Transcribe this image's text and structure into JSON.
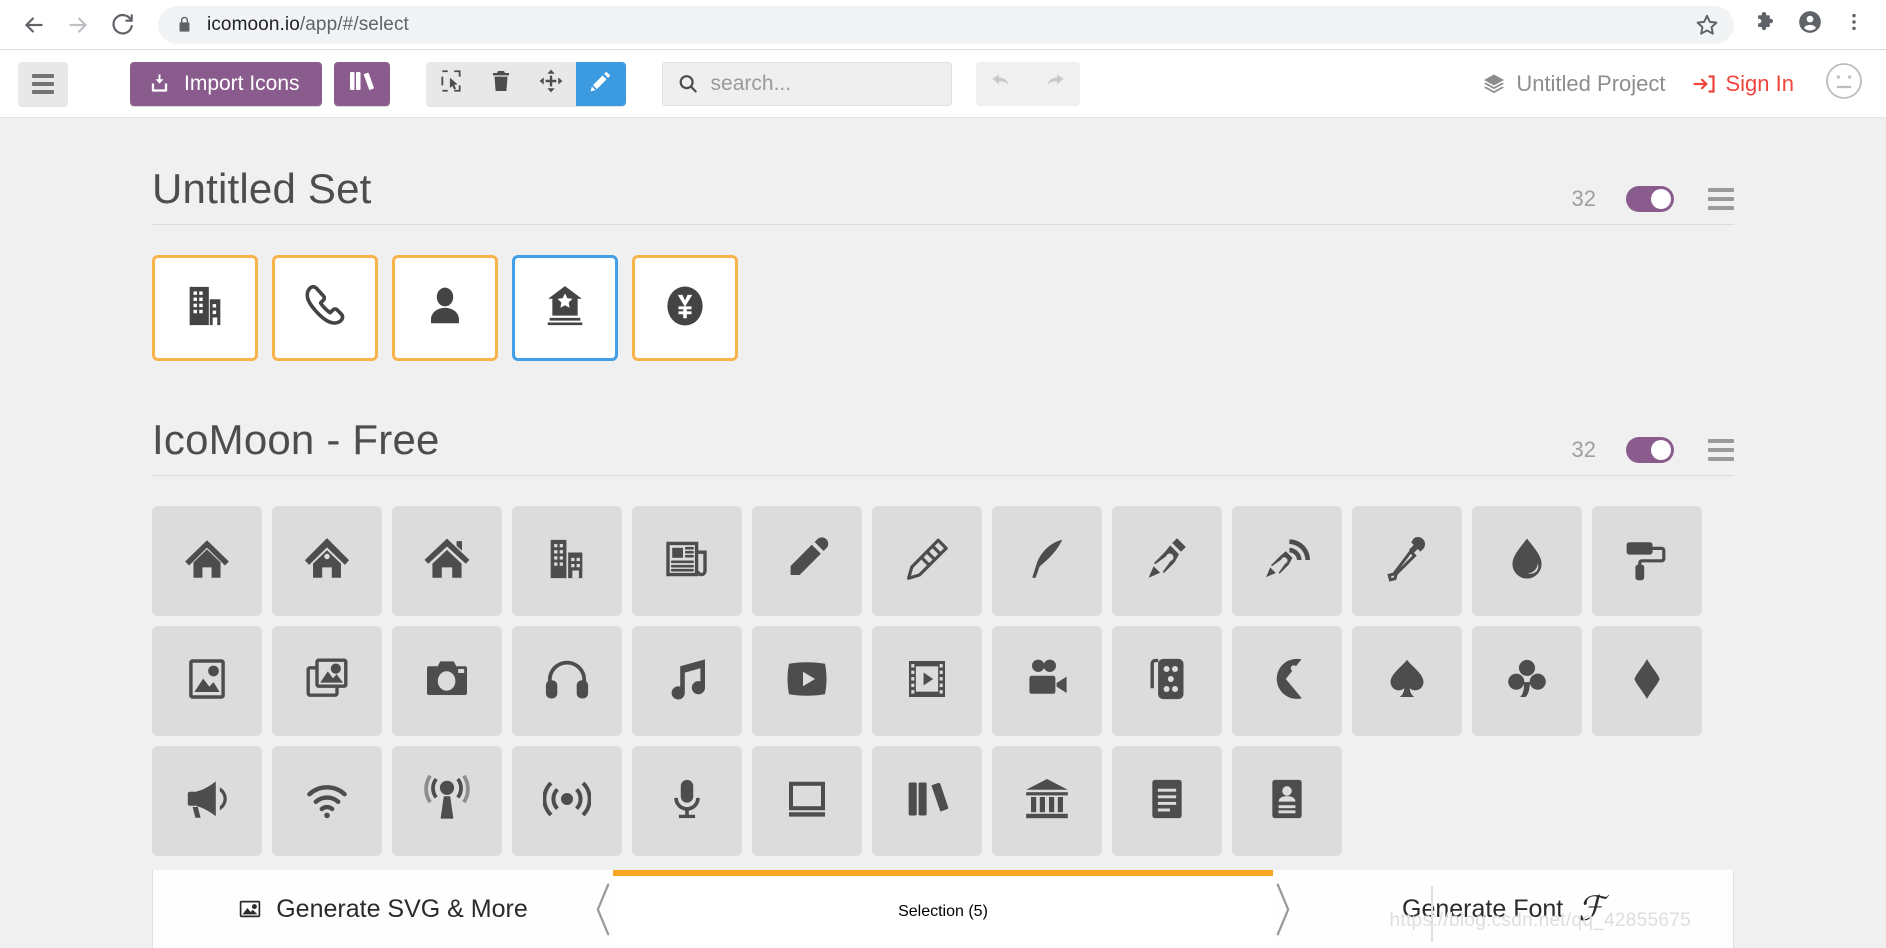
{
  "browser": {
    "back_icon": "back-arrow-icon",
    "forward_icon": "forward-arrow-icon",
    "reload_icon": "reload-icon",
    "lock_icon": "lock-icon",
    "url_domain": "icomoon.io",
    "url_path": "/app/#/select",
    "bookmark_icon": "star-icon",
    "extensions_icon": "puzzle-piece-icon",
    "profile_icon": "account-avatar-icon",
    "menu_icon": "three-dot-menu-icon"
  },
  "toolbar": {
    "menu_label": "menu",
    "import_label": "Import Icons",
    "library_label": "library",
    "tools": [
      {
        "name": "select-tool",
        "label": "Select",
        "active": false
      },
      {
        "name": "delete-tool",
        "label": "Delete",
        "active": false
      },
      {
        "name": "move-tool",
        "label": "Move",
        "active": false
      },
      {
        "name": "edit-tool",
        "label": "Edit",
        "active": true
      }
    ],
    "search_placeholder": "search...",
    "search_value": "",
    "undo_label": "Undo",
    "redo_label": "Redo",
    "project_name": "Untitled Project",
    "signin_label": "Sign In",
    "face_label": "Account"
  },
  "sets": [
    {
      "title": "Untitled Set",
      "count": "32",
      "toggle_on": true,
      "icons": [
        {
          "name": "office-building-icon",
          "selected": "orange"
        },
        {
          "name": "phone-icon",
          "selected": "orange"
        },
        {
          "name": "user-icon",
          "selected": "orange"
        },
        {
          "name": "bank-star-icon",
          "selected": "blue"
        },
        {
          "name": "yen-circle-icon",
          "selected": "orange"
        }
      ]
    },
    {
      "title": "IcoMoon - Free",
      "count": "32",
      "toggle_on": true,
      "icons": [
        {
          "name": "home-icon"
        },
        {
          "name": "home2-icon"
        },
        {
          "name": "home3-icon"
        },
        {
          "name": "office-icon"
        },
        {
          "name": "newspaper-icon"
        },
        {
          "name": "pencil-icon"
        },
        {
          "name": "pencil2-icon"
        },
        {
          "name": "quill-icon"
        },
        {
          "name": "pen-icon"
        },
        {
          "name": "blog-icon"
        },
        {
          "name": "eyedropper-icon"
        },
        {
          "name": "droplet-icon"
        },
        {
          "name": "paint-format-icon"
        },
        {
          "name": "image-icon"
        },
        {
          "name": "images-icon"
        },
        {
          "name": "camera-icon"
        },
        {
          "name": "headphones-icon"
        },
        {
          "name": "music-icon"
        },
        {
          "name": "play-icon"
        },
        {
          "name": "film-icon"
        },
        {
          "name": "video-camera-icon"
        },
        {
          "name": "dice-icon"
        },
        {
          "name": "pacman-icon"
        },
        {
          "name": "spades-icon"
        },
        {
          "name": "clubs-icon"
        },
        {
          "name": "diamonds-icon"
        },
        {
          "name": "bullhorn-icon"
        },
        {
          "name": "connection-icon"
        },
        {
          "name": "podcast-icon"
        },
        {
          "name": "feed-icon"
        },
        {
          "name": "mic-icon"
        },
        {
          "name": "book-icon"
        },
        {
          "name": "books-icon"
        },
        {
          "name": "library-icon"
        },
        {
          "name": "file-text-icon"
        },
        {
          "name": "profile-icon"
        }
      ]
    }
  ],
  "bottom_bar": {
    "generate_svg_label": "Generate SVG & More",
    "selection_label": "Selection (5)",
    "generate_font_label": "Generate Font",
    "prev_icon": "chevron-left-icon",
    "next_icon": "chevron-right-icon",
    "accent_color": "#f6a822"
  },
  "watermark": {
    "text": "https://blog.csdn.net/qq_42855675"
  },
  "colors": {
    "purple": "#8a5b8d",
    "blue": "#3c9ae0",
    "orange_border": "#f6b44a",
    "blue_border": "#42a0e8",
    "red": "#f1453d",
    "page_bg": "#f0f0f0"
  }
}
